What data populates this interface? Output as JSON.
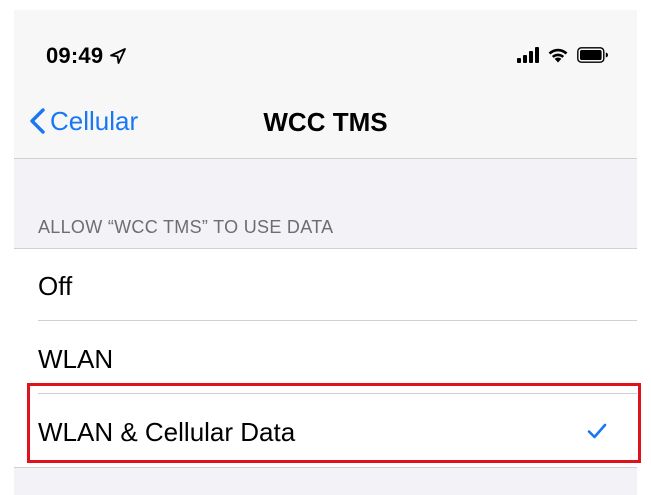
{
  "status_bar": {
    "time": "09:49",
    "icons": [
      "location-arrow-icon",
      "signal-icon",
      "wifi-icon",
      "battery-icon"
    ]
  },
  "nav": {
    "back_label": "Cellular",
    "back_icon": "chevron-left-icon",
    "title": "WCC TMS"
  },
  "section": {
    "header": "ALLOW “WCC TMS” TO USE DATA",
    "options": [
      {
        "label": "Off",
        "selected": false
      },
      {
        "label": "WLAN",
        "selected": false
      },
      {
        "label": "WLAN & Cellular Data",
        "selected": true
      }
    ]
  },
  "colors": {
    "accent": "#1977f3",
    "highlight": "#e0121b",
    "group_background": "#f2f2f7",
    "section_header": "#6d6d72"
  }
}
